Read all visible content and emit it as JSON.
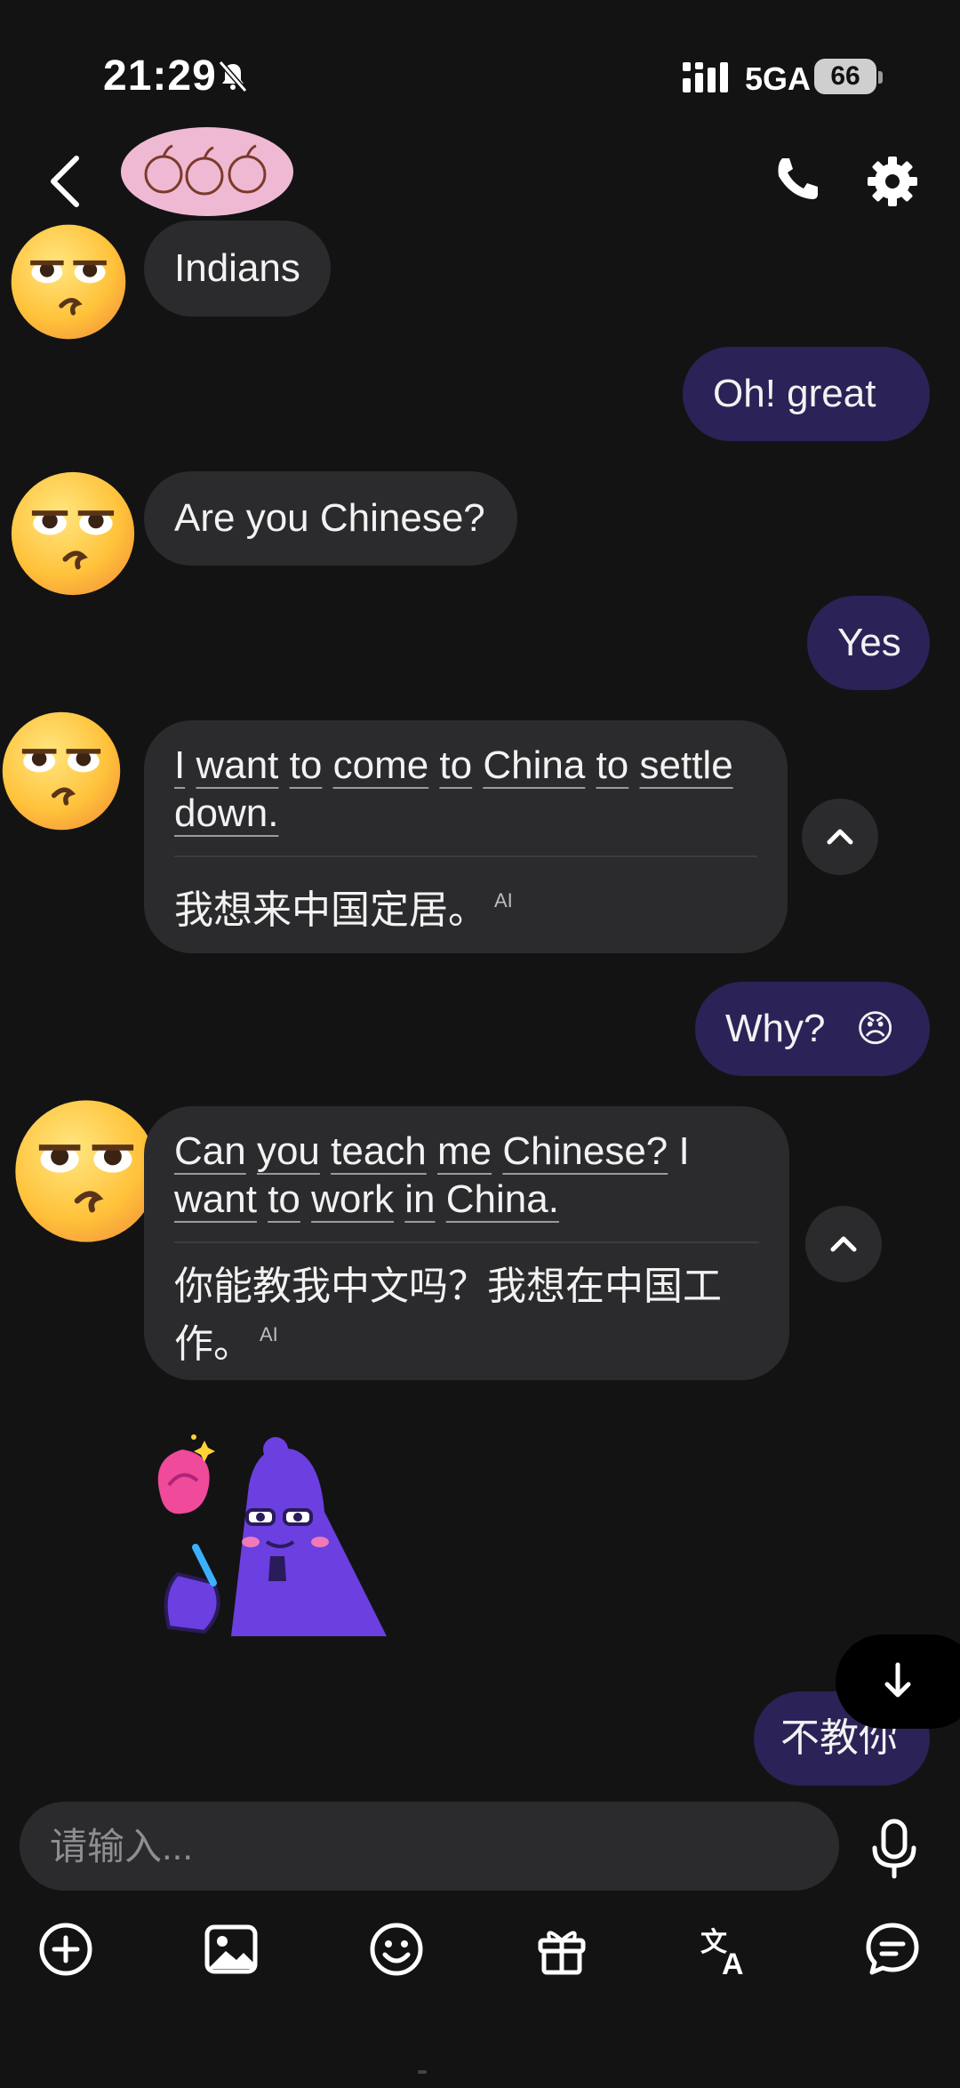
{
  "status_bar": {
    "time": "21:29",
    "network": "5GA",
    "battery": "66"
  },
  "header": {
    "icons": [
      "back-arrow-icon",
      "phone-icon",
      "gear-icon"
    ]
  },
  "messages": [
    {
      "side": "in",
      "text": "Indians"
    },
    {
      "side": "out",
      "text": "Oh!  great"
    },
    {
      "side": "in",
      "text": "Are you Chinese?"
    },
    {
      "side": "out",
      "text": "Yes"
    },
    {
      "side": "in",
      "words": [
        "I",
        "want",
        "to",
        "come",
        "to",
        "China",
        "to",
        "settle",
        "down."
      ],
      "translation": "我想来中国定居。",
      "ai_label": "AI"
    },
    {
      "side": "out",
      "text": "Why?",
      "emoji": "😠"
    },
    {
      "side": "in",
      "words": [
        "Can",
        "you",
        "teach",
        "me",
        "Chinese?",
        "I",
        "want",
        "to",
        "work",
        "in",
        "China."
      ],
      "translation": "你能教我中文吗？我想在中国工作。",
      "ai_label": "AI"
    },
    {
      "side": "in",
      "sticker": "purple-ghost-with-rose-sticker"
    },
    {
      "side": "out",
      "text": "不教你"
    }
  ],
  "composer": {
    "placeholder": "请输入..."
  },
  "toolbar": [
    "add-icon",
    "image-icon",
    "emoji-icon",
    "gift-icon",
    "translate-icon",
    "chat-icon"
  ],
  "colors": {
    "background": "#131314",
    "incoming_bubble": "#2b2b2d",
    "outgoing_bubble": "#2b2257"
  }
}
